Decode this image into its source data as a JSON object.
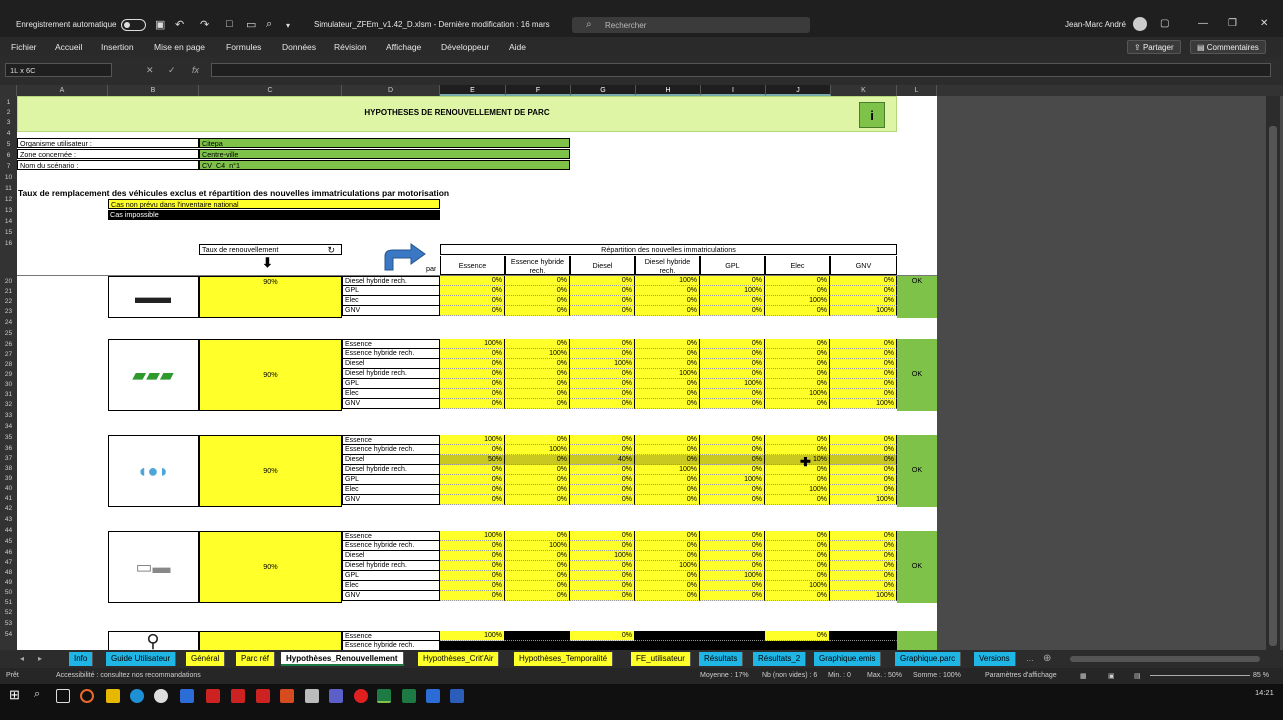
{
  "titlebar": {
    "autosave": "Enregistrement automatique",
    "filename": "Simulateur_ZFEm_v1.42_D.xlsm  -  Dernière modification : 16 mars",
    "search_placeholder": "Rechercher",
    "user": "Jean-Marc André"
  },
  "ribbon": {
    "menus": [
      "Fichier",
      "Accueil",
      "Insertion",
      "Mise en page",
      "Formules",
      "Données",
      "Révision",
      "Affichage",
      "Développeur",
      "Aide"
    ],
    "share": "Partager",
    "comments": "Commentaires"
  },
  "formula": {
    "namebox": "1L x 6C",
    "value": ""
  },
  "columns": [
    "A",
    "B",
    "C",
    "D",
    "E",
    "F",
    "G",
    "H",
    "I",
    "J",
    "K",
    "L"
  ],
  "rows": [
    "1",
    "2",
    "3",
    "4",
    "5",
    "6",
    "7",
    "10",
    "11",
    "12",
    "13",
    "14",
    "15",
    "16",
    "20",
    "21",
    "22",
    "23",
    "24",
    "25",
    "26",
    "27",
    "28",
    "29",
    "30",
    "31",
    "32",
    "33",
    "34",
    "35",
    "36",
    "37",
    "38",
    "39",
    "40",
    "41",
    "42",
    "43",
    "44",
    "45",
    "46",
    "47",
    "48",
    "49",
    "50",
    "51",
    "52",
    "53",
    "54"
  ],
  "sheet": {
    "title": "HYPOTHESES DE RENOUVELLEMENT DE PARC",
    "org_label": "Organisme utilisateur :",
    "org_value": "Citepa",
    "zone_label": "Zone concernée :",
    "zone_value": "Centre-ville",
    "scen_label": "Nom du scénario :",
    "scen_value": "CV_C4_n°1",
    "section": "Taux de remplacement des véhicules exclus et répartition des nouvelles immatriculations par motorisation",
    "legend1": "Cas non prévu dans l'inventaire national",
    "legend2": "Cas impossible",
    "taux_label": "Taux de renouvellement",
    "par": "par",
    "repart": "Répartition des nouvelles immatriculations",
    "heads": [
      "Essence",
      "Essence hybride rech.",
      "Diesel",
      "Diesel hybride rech.",
      "GPL",
      "Elec",
      "GNV"
    ],
    "blocks": [
      {
        "rate": "90%",
        "status": "OK",
        "rows": [
          [
            "Diesel hybride rech.",
            "0%",
            "0%",
            "0%",
            "100%",
            "0%",
            "0%",
            "0%"
          ],
          [
            "GPL",
            "0%",
            "0%",
            "0%",
            "0%",
            "100%",
            "0%",
            "0%"
          ],
          [
            "Elec",
            "0%",
            "0%",
            "0%",
            "0%",
            "0%",
            "100%",
            "0%"
          ],
          [
            "GNV",
            "0%",
            "0%",
            "0%",
            "0%",
            "0%",
            "0%",
            "100%"
          ]
        ]
      },
      {
        "rate": "90%",
        "status": "OK",
        "rows": [
          [
            "Essence",
            "100%",
            "0%",
            "0%",
            "0%",
            "0%",
            "0%",
            "0%"
          ],
          [
            "Essence hybride rech.",
            "0%",
            "100%",
            "0%",
            "0%",
            "0%",
            "0%",
            "0%"
          ],
          [
            "Diesel",
            "0%",
            "0%",
            "100%",
            "0%",
            "0%",
            "0%",
            "0%"
          ],
          [
            "Diesel hybride rech.",
            "0%",
            "0%",
            "0%",
            "100%",
            "0%",
            "0%",
            "0%"
          ],
          [
            "GPL",
            "0%",
            "0%",
            "0%",
            "0%",
            "100%",
            "0%",
            "0%"
          ],
          [
            "Elec",
            "0%",
            "0%",
            "0%",
            "0%",
            "0%",
            "100%",
            "0%"
          ],
          [
            "GNV",
            "0%",
            "0%",
            "0%",
            "0%",
            "0%",
            "0%",
            "100%"
          ]
        ]
      },
      {
        "rate": "90%",
        "status": "OK",
        "rows": [
          [
            "Essence",
            "100%",
            "0%",
            "0%",
            "0%",
            "0%",
            "0%",
            "0%"
          ],
          [
            "Essence hybride rech.",
            "0%",
            "100%",
            "0%",
            "0%",
            "0%",
            "0%",
            "0%"
          ],
          [
            "Diesel",
            "50%",
            "0%",
            "40%",
            "0%",
            "0%",
            "10%",
            "0%"
          ],
          [
            "Diesel hybride rech.",
            "0%",
            "0%",
            "0%",
            "100%",
            "0%",
            "0%",
            "0%"
          ],
          [
            "GPL",
            "0%",
            "0%",
            "0%",
            "0%",
            "100%",
            "0%",
            "0%"
          ],
          [
            "Elec",
            "0%",
            "0%",
            "0%",
            "0%",
            "0%",
            "100%",
            "0%"
          ],
          [
            "GNV",
            "0%",
            "0%",
            "0%",
            "0%",
            "0%",
            "0%",
            "100%"
          ]
        ]
      },
      {
        "rate": "90%",
        "status": "OK",
        "rows": [
          [
            "Essence",
            "100%",
            "0%",
            "0%",
            "0%",
            "0%",
            "0%",
            "0%"
          ],
          [
            "Essence hybride rech.",
            "0%",
            "100%",
            "0%",
            "0%",
            "0%",
            "0%",
            "0%"
          ],
          [
            "Diesel",
            "0%",
            "0%",
            "100%",
            "0%",
            "0%",
            "0%",
            "0%"
          ],
          [
            "Diesel hybride rech.",
            "0%",
            "0%",
            "0%",
            "100%",
            "0%",
            "0%",
            "0%"
          ],
          [
            "GPL",
            "0%",
            "0%",
            "0%",
            "0%",
            "100%",
            "0%",
            "0%"
          ],
          [
            "Elec",
            "0%",
            "0%",
            "0%",
            "0%",
            "0%",
            "100%",
            "0%"
          ],
          [
            "GNV",
            "0%",
            "0%",
            "0%",
            "0%",
            "0%",
            "0%",
            "100%"
          ]
        ]
      },
      {
        "rate": "",
        "status": "",
        "rows": [
          [
            "Essence",
            "100%",
            "",
            "0%",
            "",
            "",
            "0%",
            ""
          ],
          [
            "Essence hybride rech.",
            "",
            "",
            "",
            "",
            "",
            "",
            ""
          ]
        ]
      }
    ]
  },
  "tabs": [
    {
      "label": "Info",
      "color": "#1fb6e6"
    },
    {
      "label": "Guide Utilisateur",
      "color": "#1fb6e6"
    },
    {
      "label": "Général",
      "color": "#ffff2a"
    },
    {
      "label": "Parc réf",
      "color": "#ffff2a"
    },
    {
      "label": "Hypothèses_Renouvellement",
      "color": "#ffffff"
    },
    {
      "label": "Hypothèses_Crit'Air",
      "color": "#ffff2a"
    },
    {
      "label": "Hypothèses_Temporalité",
      "color": "#ffff2a"
    },
    {
      "label": "FE_utilisateur",
      "color": "#ffff2a"
    },
    {
      "label": "Résultats",
      "color": "#1fb6e6"
    },
    {
      "label": "Résultats_2",
      "color": "#1fb6e6"
    },
    {
      "label": "Graphique.emis",
      "color": "#1fb6e6"
    },
    {
      "label": "Graphique.parc",
      "color": "#1fb6e6"
    },
    {
      "label": "Versions",
      "color": "#1fb6e6"
    }
  ],
  "status": {
    "ready": "Prêt",
    "access": "Accessibilité : consultez nos recommandations",
    "avg": "Moyenne : 17%",
    "count": "Nb (non vides) : 6",
    "min": "Min. : 0",
    "max": "Max. : 50%",
    "sum": "Somme : 100%",
    "display": "Paramètres d'affichage",
    "zoom": "85 %"
  },
  "taskbar": {
    "time": "14:21"
  }
}
